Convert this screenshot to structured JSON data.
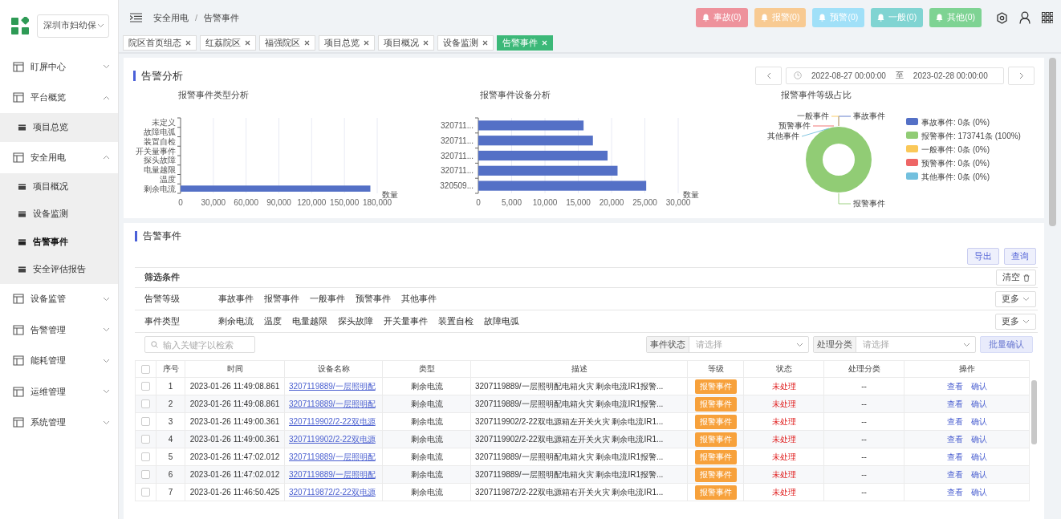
{
  "sidebar": {
    "org_selector": {
      "value": "深圳市妇幼保"
    },
    "items": [
      {
        "label": "盯屏中心",
        "expanded": false
      },
      {
        "label": "平台概览",
        "expanded": true,
        "children": [
          {
            "label": "项目总览",
            "selected": false
          }
        ]
      },
      {
        "label": "安全用电",
        "expanded": true,
        "children": [
          {
            "label": "项目概况",
            "selected": false
          },
          {
            "label": "设备监测",
            "selected": false
          },
          {
            "label": "告警事件",
            "selected": true
          },
          {
            "label": "安全评估报告",
            "selected": false
          }
        ]
      },
      {
        "label": "设备监管",
        "expanded": false
      },
      {
        "label": "告警管理",
        "expanded": false
      },
      {
        "label": "能耗管理",
        "expanded": false
      },
      {
        "label": "运维管理",
        "expanded": false
      },
      {
        "label": "系统管理",
        "expanded": false
      }
    ]
  },
  "header": {
    "breadcrumb": {
      "items": [
        "安全用电",
        "告警事件"
      ],
      "separator": "/"
    },
    "alert_buttons": [
      {
        "label": "事故(0)",
        "color": "#ee929c"
      },
      {
        "label": "报警(0)",
        "color": "#f8ca92"
      },
      {
        "label": "预警(0)",
        "color": "#a0e0f8"
      },
      {
        "label": "一般(0)",
        "color": "#80d4d2"
      },
      {
        "label": "其他(0)",
        "color": "#7ed393"
      }
    ]
  },
  "tabs": [
    {
      "label": "院区首页组态",
      "selected": false
    },
    {
      "label": "红荔院区",
      "selected": false
    },
    {
      "label": "福强院区",
      "selected": false
    },
    {
      "label": "项目总览",
      "selected": false
    },
    {
      "label": "项目概况",
      "selected": false
    },
    {
      "label": "设备监测",
      "selected": false
    },
    {
      "label": "告警事件",
      "selected": true
    }
  ],
  "analysis": {
    "title": "告警分析",
    "date_range": {
      "start": "2022-08-27 00:00:00",
      "separator": "至",
      "end": "2023-02-28 00:00:00"
    },
    "type_chart": {
      "chart_data": {
        "type": "bar",
        "orientation": "horizontal",
        "title": "报警事件类型分析",
        "xlabel": "数量",
        "grid": true,
        "categories": [
          "未定义",
          "故障电弧",
          "装置自检",
          "开关量事件",
          "探头故障",
          "电量越限",
          "温度",
          "剩余电流"
        ],
        "series": [
          {
            "color": "#5470c6",
            "values": [
              0,
              0,
              0,
              0,
              0,
              0,
              0,
              173741
            ]
          }
        ],
        "xlim": [
          0,
          180000
        ],
        "xticks": [
          {
            "value": 0,
            "label": "0"
          },
          {
            "value": 30000,
            "label": "30,000"
          },
          {
            "value": 60000,
            "label": "60,000"
          },
          {
            "value": 90000,
            "label": "90,000"
          },
          {
            "value": 120000,
            "label": "120,000"
          },
          {
            "value": 150000,
            "label": "150,000"
          },
          {
            "value": 180000,
            "label": "180,000"
          }
        ]
      }
    },
    "device_chart": {
      "chart_data": {
        "type": "bar",
        "orientation": "horizontal",
        "title": "报警事件设备分析",
        "xlabel": "数量",
        "grid": true,
        "categories": [
          "320711...",
          "320711...",
          "320711...",
          "320711...",
          "320509..."
        ],
        "series": [
          {
            "color": "#5470c6",
            "values": [
              15800,
              17200,
              19400,
              20900,
              25200
            ]
          }
        ],
        "xlim": [
          0,
          30000
        ],
        "xticks": [
          {
            "value": 0,
            "label": "0"
          },
          {
            "value": 5000,
            "label": "5,000"
          },
          {
            "value": 10000,
            "label": "10,000"
          },
          {
            "value": 15000,
            "label": "15,000"
          },
          {
            "value": 20000,
            "label": "20,000"
          },
          {
            "value": 25000,
            "label": "25,000"
          },
          {
            "value": 30000,
            "label": "30,000"
          }
        ]
      }
    },
    "level_chart": {
      "chart_data": {
        "type": "pie",
        "title": "报警事件等级占比",
        "categories": [
          "事故事件",
          "报警事件",
          "一般事件",
          "预警事件",
          "其他事件"
        ],
        "series": [
          {
            "values": [
              0,
              100,
              0,
              0,
              0
            ]
          }
        ],
        "colors": [
          "#5470c6",
          "#91cc75",
          "#fac858",
          "#ee6666",
          "#73c0de"
        ]
      },
      "legend": [
        "事故事件: 0条 (0%)",
        "报警事件: 173741条 (100%)",
        "一般事件: 0条 (0%)",
        "预警事件: 0条 (0%)",
        "其他事件: 0条 (0%)"
      ]
    }
  },
  "events": {
    "title": "告警事件",
    "buttons": [
      "导出",
      "查询"
    ],
    "filters": {
      "title": "筛选条件",
      "clear_button": "清空",
      "rows": [
        {
          "label": "告警等级",
          "options": [
            "事故事件",
            "报警事件",
            "一般事件",
            "预警事件",
            "其他事件"
          ],
          "more_button": "更多"
        },
        {
          "label": "事件类型",
          "options": [
            "剩余电流",
            "温度",
            "电量越限",
            "探头故障",
            "开关量事件",
            "装置自检",
            "故障电弧"
          ],
          "more_button": "更多"
        }
      ]
    },
    "search": {
      "placeholder": "输入关键字以检索"
    },
    "selects": [
      {
        "label": "事件状态",
        "placeholder": "请选择"
      },
      {
        "label": "处理分类",
        "placeholder": "请选择"
      }
    ],
    "batch_button": {
      "label": "批量确认",
      "disabled": true
    },
    "table": {
      "select_all_checked": false,
      "columns": [
        "序号",
        "时间",
        "设备名称",
        "类型",
        "描述",
        "等级",
        "状态",
        "处理分类",
        "操作"
      ],
      "rows": [
        {
          "checked": false,
          "no": "1",
          "time": "2023-01-26 11:49:08.861",
          "device": "3207119889/一层照明配",
          "type": "剩余电流",
          "description": "3207119889/一层照明配电箱火灾 剩余电流IR1报警...",
          "level": "报警事件",
          "status": "未处理",
          "category": "--",
          "actions": [
            "查看",
            "确认"
          ]
        },
        {
          "checked": false,
          "no": "2",
          "time": "2023-01-26 11:49:08.861",
          "device": "3207119889/一层照明配",
          "type": "剩余电流",
          "description": "3207119889/一层照明配电箱火灾 剩余电流IR1报警...",
          "level": "报警事件",
          "status": "未处理",
          "category": "--",
          "actions": [
            "查看",
            "确认"
          ]
        },
        {
          "checked": false,
          "no": "3",
          "time": "2023-01-26 11:49:00.361",
          "device": "3207119902/2-22双电源",
          "type": "剩余电流",
          "description": "3207119902/2-22双电源箱左开关火灾 剩余电流IR1...",
          "level": "报警事件",
          "status": "未处理",
          "category": "--",
          "actions": [
            "查看",
            "确认"
          ]
        },
        {
          "checked": false,
          "no": "4",
          "time": "2023-01-26 11:49:00.361",
          "device": "3207119902/2-22双电源",
          "type": "剩余电流",
          "description": "3207119902/2-22双电源箱左开关火灾 剩余电流IR1...",
          "level": "报警事件",
          "status": "未处理",
          "category": "--",
          "actions": [
            "查看",
            "确认"
          ]
        },
        {
          "checked": false,
          "no": "5",
          "time": "2023-01-26 11:47:02.012",
          "device": "3207119889/一层照明配",
          "type": "剩余电流",
          "description": "3207119889/一层照明配电箱火灾 剩余电流IR1报警...",
          "level": "报警事件",
          "status": "未处理",
          "category": "--",
          "actions": [
            "查看",
            "确认"
          ]
        },
        {
          "checked": false,
          "no": "6",
          "time": "2023-01-26 11:47:02.012",
          "device": "3207119889/一层照明配",
          "type": "剩余电流",
          "description": "3207119889/一层照明配电箱火灾 剩余电流IR1报警...",
          "level": "报警事件",
          "status": "未处理",
          "category": "--",
          "actions": [
            "查看",
            "确认"
          ]
        },
        {
          "checked": false,
          "no": "7",
          "time": "2023-01-26 11:46:50.425",
          "device": "3207119872/2-22双电源",
          "type": "剩余电流",
          "description": "3207119872/2-22双电源箱右开关火灾 剩余电流IR1...",
          "level": "报警事件",
          "status": "未处理",
          "category": "--",
          "actions": [
            "查看",
            "确认"
          ]
        }
      ]
    }
  }
}
